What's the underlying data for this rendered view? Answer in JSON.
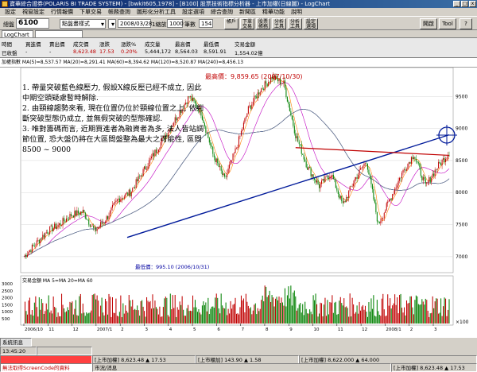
{
  "window": {
    "title": "寶華綜合證券(POLARIS BI TRADE SYSTEM) - [bwkit605,1978] - [B100] 股票技術指標分析器 - 上市加權(日線圖) - LogChart"
  },
  "menu": [
    "設定",
    "視窗設定",
    "行情報價",
    "下單交易",
    "帳務查詢",
    "圖形化分析工具",
    "設定選項",
    "綜合查詢",
    "新聞區",
    "精華功能",
    "說明"
  ],
  "toolbar": {
    "label_code": "總盤",
    "code": "6100",
    "mode": "點盤畫樣式",
    "date": "2008/03/28",
    "zoom_label": "1縮放",
    "zoom_value": "1000",
    "bars_label": "筆數",
    "bars_value": "154",
    "btn_a": "帳戶",
    "btn_b": "下單交易",
    "btn_c": "股票帳務",
    "btn_d": "分析工具",
    "btn_e": "分析工具",
    "btn_f": "設定選項",
    "right_btn1": "開啟",
    "right_btn2": "Tool"
  },
  "toolbar2": {
    "chart_name": "LogChart"
  },
  "price_table": {
    "headers": [
      "時間",
      "買進價",
      "賣出價",
      "成交價",
      "漲跌",
      "漲跌%",
      "成交量",
      "最高價",
      "最低價",
      "交易金額"
    ],
    "values": [
      "已收盤",
      "-",
      "-",
      "8,623.48",
      "17.53",
      "0.20%",
      "5,444,172",
      "8,564.03",
      "8,591.91",
      "1,554.02億"
    ]
  },
  "chart_header": "加權指數   MA(5)=8,537.57  MA(20)=8,291.41  MA(60)=8,394.62  MA(120)=8,520.87  MA(240)=8,456.13",
  "annotation": {
    "high_label": "最高價：9,859.65 (2007/10/30)",
    "low_label": "最低價：995.10 (2006/10/31)",
    "lines": [
      "1. 帶量突破藍色線壓力, 假設X線反壓已經不成立, 因此中期空頭疑慮暫時解除.",
      "2. 由頸線趨勢來看, 現在位置仍位於頸線位置之上, 依判斷突破型態仍成立, 並無假突破的型態確認.",
      "3. 唯對籌碼而言, 近期買進者為融資者為多, 法人皆站調節位置, 恐大盤仍將在大區間盤整為最大之可能性, 區間8500 ~ 9000"
    ]
  },
  "y_axis_ticks": [
    "9500",
    "9000",
    "8500",
    "8000",
    "7500",
    "7000"
  ],
  "x_axis_ticks": [
    "2006/10",
    "11",
    "12",
    "2007/1",
    "2",
    "3",
    "4",
    "5",
    "6",
    "7",
    "8",
    "9",
    "10",
    "11",
    "12",
    "2008/1",
    "2",
    "3"
  ],
  "volume_header": "交易金額   MA  5=MA  20=MA  60",
  "volume_ticks": [
    "3000",
    "2500",
    "2000",
    "1500",
    "1000",
    "500"
  ],
  "volume_unit": "×100",
  "status": {
    "time": "13:45:20",
    "row1": [
      "[上市加權]   8,623.48 ▲ 17.53",
      "[上市櫃加]   143.90 ▲ 1.58",
      "[上市加權]   8,622.000 ▲ 64.000"
    ],
    "row2_left": "無法取得ScreenCode的資料",
    "row2_mid": "市況/消息",
    "row2_right": "[上市加權]  8,623.48 ▲ 17.53"
  },
  "chart_data": {
    "type": "line",
    "title": "上市加權(日線圖)",
    "ylim": [
      6800,
      9900
    ],
    "price_series_description_points": [
      [
        0,
        7000
      ],
      [
        10,
        7200
      ],
      [
        20,
        7400
      ],
      [
        30,
        7500
      ],
      [
        40,
        7650
      ],
      [
        50,
        7700
      ],
      [
        60,
        7400
      ],
      [
        70,
        7600
      ],
      [
        80,
        7900
      ],
      [
        90,
        8000
      ],
      [
        100,
        8300
      ],
      [
        110,
        8600
      ],
      [
        120,
        8900
      ],
      [
        130,
        9200
      ],
      [
        140,
        9500
      ],
      [
        150,
        9250
      ],
      [
        160,
        8600
      ],
      [
        170,
        8200
      ],
      [
        180,
        8700
      ],
      [
        190,
        9300
      ],
      [
        200,
        9600
      ],
      [
        210,
        9800
      ],
      [
        220,
        9700
      ],
      [
        230,
        8900
      ],
      [
        240,
        8400
      ],
      [
        250,
        8100
      ],
      [
        260,
        8300
      ],
      [
        270,
        7800
      ],
      [
        280,
        8200
      ],
      [
        290,
        8500
      ],
      [
        300,
        7500
      ],
      [
        310,
        7900
      ],
      [
        320,
        8300
      ],
      [
        330,
        8600
      ],
      [
        340,
        8100
      ],
      [
        350,
        8400
      ],
      [
        360,
        8623
      ]
    ],
    "trendline_blue": {
      "from": [
        0,
        7300
      ],
      "to": [
        360,
        8900
      ]
    },
    "trendline_red": {
      "from": [
        230,
        8700
      ],
      "to": [
        360,
        8580
      ]
    }
  }
}
